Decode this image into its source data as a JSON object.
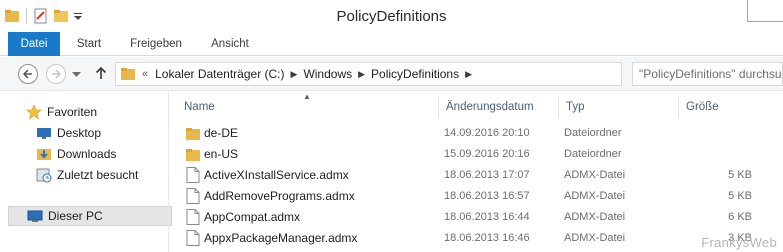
{
  "window": {
    "title": "PolicyDefinitions"
  },
  "ribbon": {
    "tabs": [
      {
        "label": "Datei",
        "active": true
      },
      {
        "label": "Start"
      },
      {
        "label": "Freigeben"
      },
      {
        "label": "Ansicht"
      }
    ]
  },
  "address": {
    "overflow": "«",
    "crumbs": [
      "Lokaler Datenträger (C:)",
      "Windows",
      "PolicyDefinitions"
    ]
  },
  "search": {
    "placeholder": "\"PolicyDefinitions\" durchsuchen"
  },
  "nav": {
    "items": [
      {
        "label": "Favoriten",
        "icon": "star-icon"
      },
      {
        "label": "Desktop",
        "icon": "desktop-icon"
      },
      {
        "label": "Downloads",
        "icon": "downloads-icon"
      },
      {
        "label": "Zuletzt besucht",
        "icon": "recent-places-icon"
      },
      {
        "label": "Dieser PC",
        "icon": "computer-icon",
        "selected": true
      }
    ]
  },
  "columns": {
    "name": "Name",
    "date": "Änderungsdatum",
    "type": "Typ",
    "size": "Größe"
  },
  "files": [
    {
      "name": "de-DE",
      "date": "14.09.2016 20:10",
      "type": "Dateiordner",
      "size": "",
      "kind": "folder"
    },
    {
      "name": "en-US",
      "date": "15.09.2016 20:16",
      "type": "Dateiordner",
      "size": "",
      "kind": "folder"
    },
    {
      "name": "ActiveXInstallService.admx",
      "date": "18.06.2013 17:07",
      "type": "ADMX-Datei",
      "size": "5 KB",
      "kind": "file"
    },
    {
      "name": "AddRemovePrograms.admx",
      "date": "18.06.2013 16:57",
      "type": "ADMX-Datei",
      "size": "5 KB",
      "kind": "file"
    },
    {
      "name": "AppCompat.admx",
      "date": "18.06.2013 16:44",
      "type": "ADMX-Datei",
      "size": "6 KB",
      "kind": "file"
    },
    {
      "name": "AppxPackageManager.admx",
      "date": "18.06.2013 16:46",
      "type": "ADMX-Datei",
      "size": "3 KB",
      "kind": "file"
    }
  ],
  "watermark": "FrankysWeb",
  "colors": {
    "accent": "#1979ca",
    "folder": "#e8b84a",
    "header_text": "#4c607a"
  }
}
